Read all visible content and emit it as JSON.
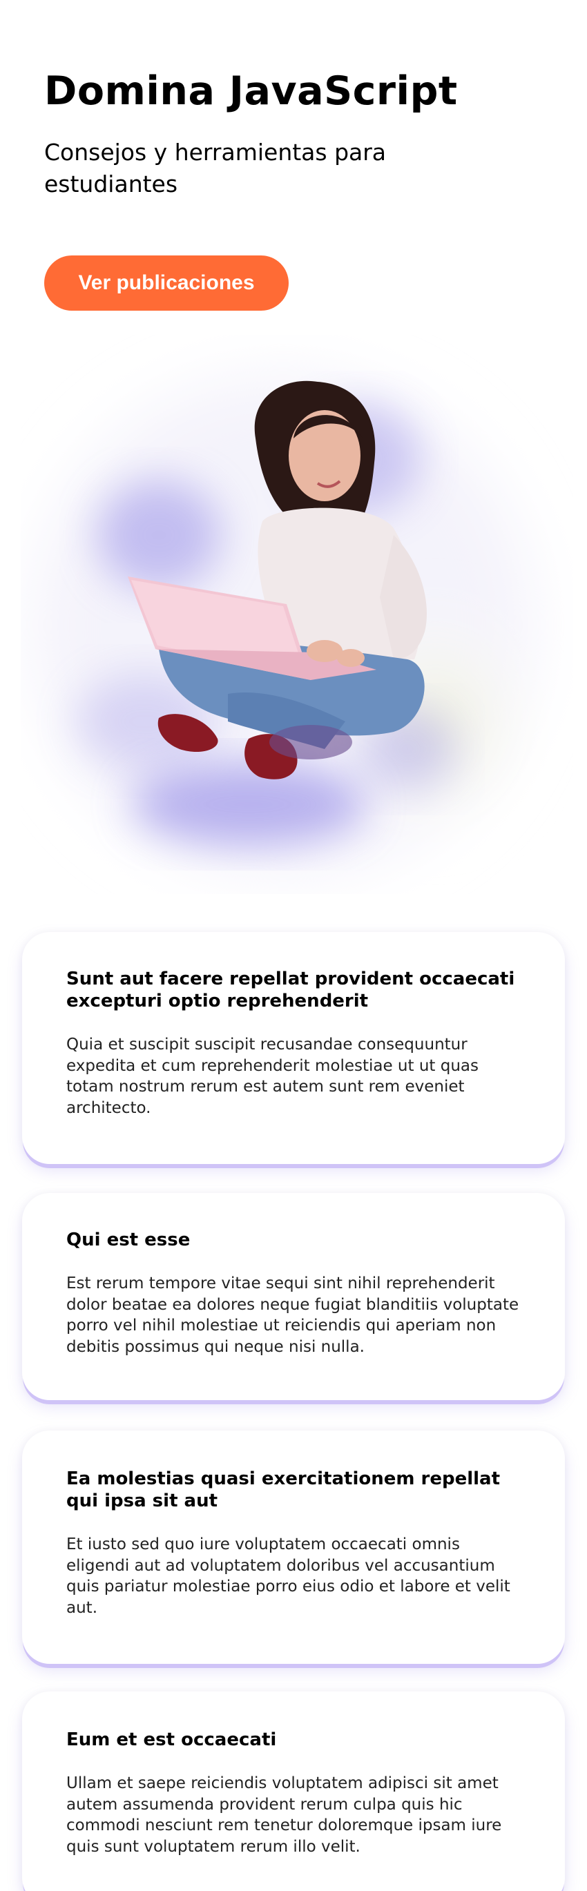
{
  "hero": {
    "title": "Domina JavaScript",
    "subtitle": "Consejos y herramientas para estudiantes",
    "cta_label": "Ver publicaciones",
    "cta_color": "#ff6b35"
  },
  "illustration": {
    "icon": "student-with-laptop-illustration",
    "blob_color": "#8f86e6"
  },
  "posts": [
    {
      "title": "Sunt aut facere repellat provident occaecati excepturi optio reprehenderit",
      "body": "Quia et suscipit suscipit recusandae consequuntur expedita et cum reprehenderit molestiae ut ut quas totam nostrum rerum est autem sunt rem eveniet architecto."
    },
    {
      "title": "Qui est esse",
      "body": "Est rerum tempore vitae sequi sint nihil reprehenderit dolor beatae ea dolores neque fugiat blanditiis voluptate porro vel nihil molestiae ut reiciendis qui aperiam non debitis possimus qui neque nisi nulla."
    },
    {
      "title": "Ea molestias quasi exercitationem repellat qui ipsa sit aut",
      "body": "Et iusto sed quo iure voluptatem occaecati omnis eligendi aut ad voluptatem doloribus vel accusantium quis pariatur molestiae porro eius odio et labore et velit aut."
    },
    {
      "title": "Eum et est occaecati",
      "body": "Ullam et saepe reiciendis voluptatem adipisci sit amet autem assumenda provident rerum culpa quis hic commodi nesciunt rem tenetur doloremque ipsam iure quis sunt voluptatem rerum illo velit."
    }
  ]
}
